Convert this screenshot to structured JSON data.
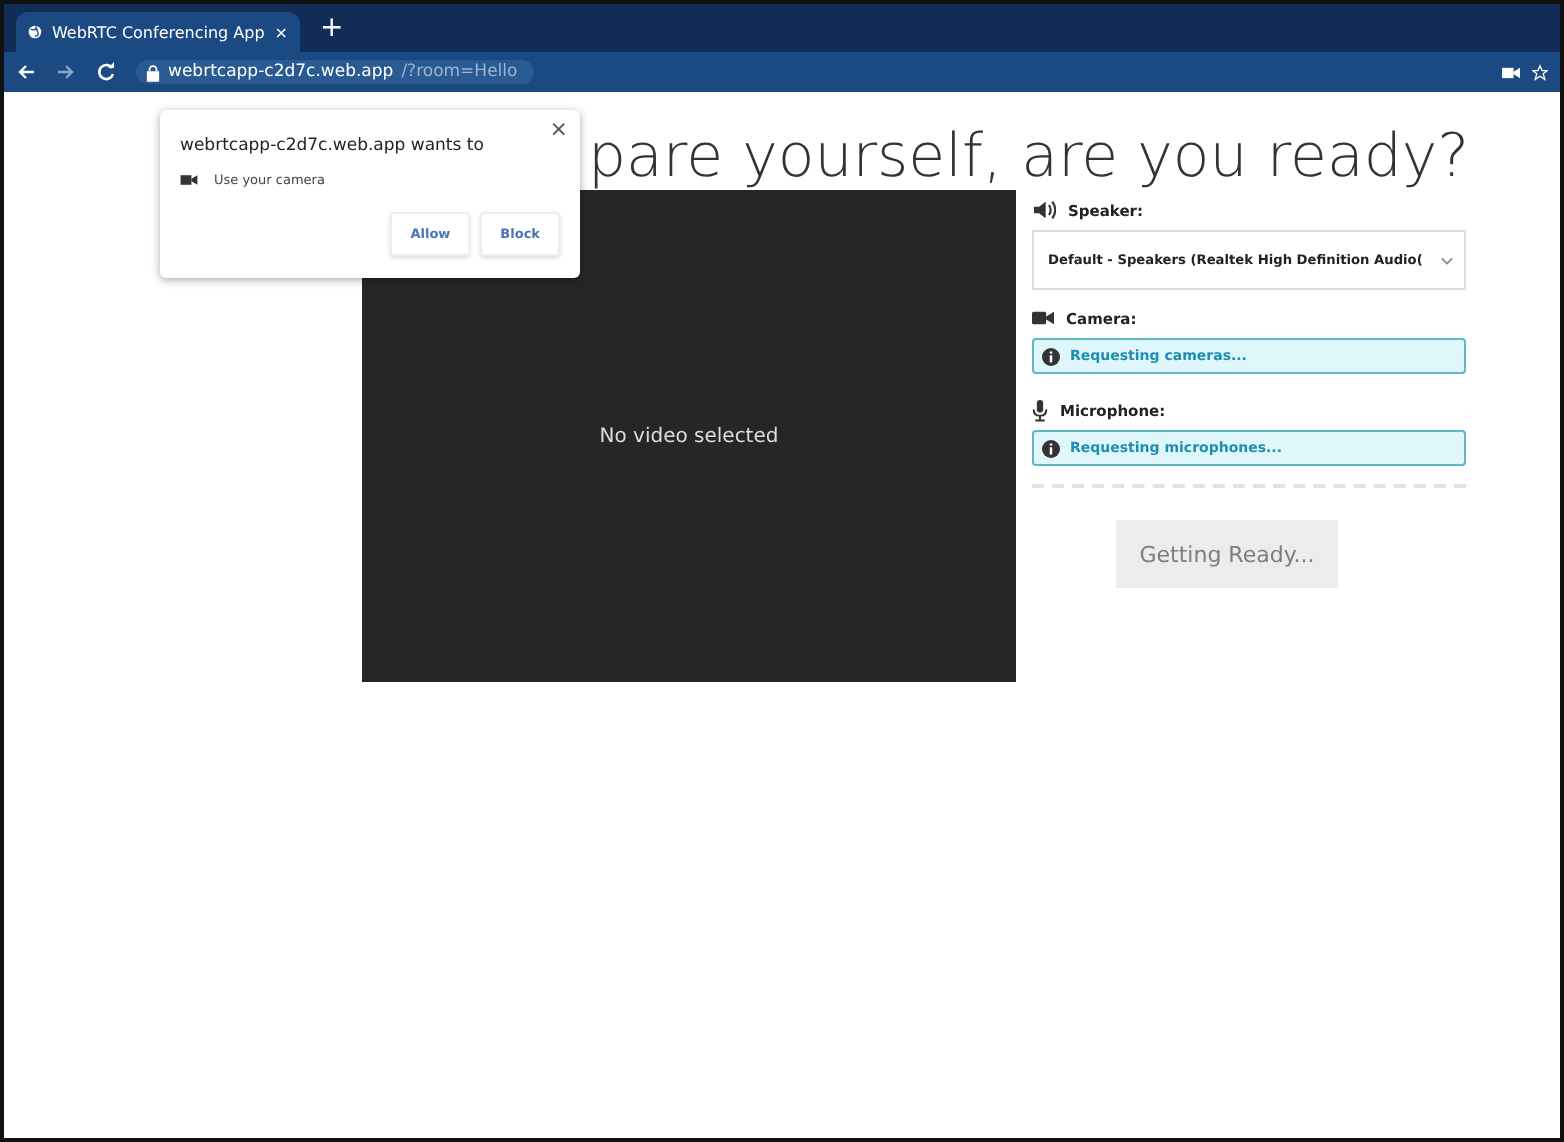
{
  "browser": {
    "tab": {
      "title": "WebRTC Conferencing App",
      "close": "×"
    },
    "new_tab": "+",
    "url": {
      "host": "webrtcapp-c2d7c.web.app",
      "path": "/?room=Hello"
    }
  },
  "permission_popup": {
    "title": "webrtcapp-c2d7c.web.app wants to",
    "close": "×",
    "request": "Use your camera",
    "buttons": [
      "Allow",
      "Block"
    ]
  },
  "heading": "pare yourself, are you ready?",
  "video": {
    "message": "No video selected"
  },
  "settings": [
    {
      "kind": "select",
      "label": "Speaker:",
      "value": "Default - Speakers (Realtek High Definition Audio("
    },
    {
      "kind": "status",
      "label": "Camera:",
      "message": "Requesting cameras..."
    },
    {
      "kind": "status",
      "label": "Microphone:",
      "message": "Requesting microphones..."
    }
  ],
  "ready_button": {
    "label": "Getting Ready...",
    "disabled": true
  }
}
